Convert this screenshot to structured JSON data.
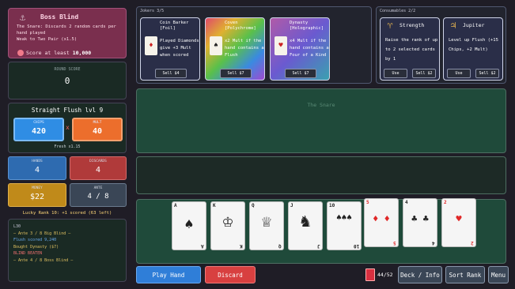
{
  "boss": {
    "title": "Boss Blind",
    "desc": "The Snare: Discards 2 random cards per hand played",
    "desc2": "Weak to Two Pair (x1.5)",
    "req_label": "Score at least",
    "req_value": "10,000"
  },
  "round_score": {
    "label": "ROUND SCORE",
    "value": "0"
  },
  "hand_info": {
    "name": "Straight Flush lvl 9",
    "chips_label": "CHIPS",
    "chips": "420",
    "mult_label": "MULT",
    "mult": "40",
    "times": "x",
    "fresh": "Fresh x1.15"
  },
  "stats": {
    "hands_label": "HANDS",
    "hands": "4",
    "discards_label": "DISCARDS",
    "discards": "4",
    "money_label": "MONEY",
    "money": "$22",
    "ante_label": "ANTE",
    "ante": "4 / 8"
  },
  "lucky": "Lucky Rank 10: +1 scored (63 left)",
  "log": [
    "L30",
    "— Ante 3 / 8 Big Blind —",
    "Flush scored 9,240",
    "Bought Dynasty ($7)",
    "BLIND BEATEN",
    "— Ante 4 / 8 Boss Blind —"
  ],
  "jokers": {
    "header": "Jokers 3/5",
    "cards": [
      {
        "name": "Coin Barker [Foil]",
        "desc": "Played Diamonds give +3 Mult when scored",
        "sell": "Sell $4",
        "img": "♦"
      },
      {
        "name": "Coven [Polychrome]",
        "desc": "x2 Mult if the hand contains a Flush",
        "sell": "Sell $7",
        "img": "♠"
      },
      {
        "name": "Dynasty [Holographic]",
        "desc": "x4 Mult if the hand contains a Four of a Kind",
        "sell": "Sell $7",
        "img": "♥"
      }
    ]
  },
  "consumables": {
    "header": "Consumables 2/2",
    "cards": [
      {
        "name": "Strength",
        "desc": "Raise the rank of up to 2 selected cards by 1",
        "use": "Use",
        "sell": "Sell $2",
        "icon": "♈"
      },
      {
        "name": "Jupiter",
        "desc": "Level up Flush (+15 Chips, +2 Mult)",
        "use": "Use",
        "sell": "Sell $2",
        "icon": "♃"
      }
    ]
  },
  "play_area": {
    "label": "The Snare"
  },
  "hand_cards": [
    {
      "rank": "A",
      "suit": "♠",
      "color": "black",
      "face": false,
      "mid": "♠"
    },
    {
      "rank": "K",
      "suit": "♠",
      "color": "black",
      "face": true,
      "mid": "♔"
    },
    {
      "rank": "Q",
      "suit": "♠",
      "color": "black",
      "face": true,
      "mid": "♕"
    },
    {
      "rank": "J",
      "suit": "♠",
      "color": "black",
      "face": true,
      "mid": "♞"
    },
    {
      "rank": "10",
      "suit": "♠",
      "color": "black",
      "face": false,
      "mid": "♠♠♠"
    },
    {
      "rank": "5",
      "suit": "♦",
      "color": "red",
      "face": false,
      "mid": "♦ ♦"
    },
    {
      "rank": "4",
      "suit": "♣",
      "color": "black",
      "face": false,
      "mid": "♣ ♣"
    },
    {
      "rank": "2",
      "suit": "♥",
      "color": "red",
      "face": false,
      "mid": "♥"
    }
  ],
  "buttons": {
    "play": "Play Hand",
    "discard": "Discard",
    "deck_count": "44/52",
    "deck": "Deck / Info",
    "sort": "Sort Rank",
    "menu": "Menu"
  },
  "colors": {
    "chips": "#2f8de4",
    "mult": "#ec6e2c",
    "boss": "#7a2f4e",
    "felt": "#1f4a3a"
  }
}
